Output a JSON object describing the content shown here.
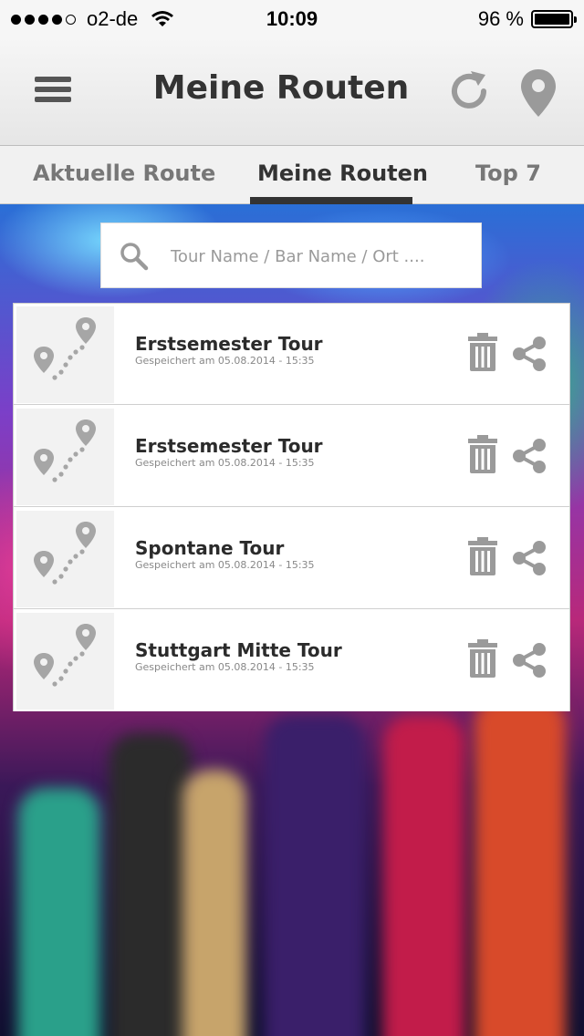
{
  "status_bar": {
    "carrier": "o2-de",
    "time": "10:09",
    "battery": "96 %",
    "signal_bars_filled": 4,
    "signal_bars_total": 5
  },
  "nav": {
    "title": "Meine Routen",
    "menu_icon": "hamburger-menu-icon",
    "refresh_icon": "refresh-icon",
    "location_icon": "location-pin-icon"
  },
  "tabs": [
    {
      "label": "Aktuelle Route",
      "active": false
    },
    {
      "label": "Meine Routen",
      "active": true
    },
    {
      "label": "Top 7",
      "active": false
    }
  ],
  "search": {
    "placeholder": "Tour Name / Bar Name / Ort ....",
    "value": "",
    "icon": "search-icon"
  },
  "routes": [
    {
      "title": "Erstsemester Tour",
      "subtitle": "Gespeichert am 05.08.2014 - 15:35"
    },
    {
      "title": "Erstsemester Tour",
      "subtitle": "Gespeichert am 05.08.2014 - 15:35"
    },
    {
      "title": "Spontane Tour",
      "subtitle": "Gespeichert am 05.08.2014 - 15:35"
    },
    {
      "title": "Stuttgart Mitte Tour",
      "subtitle": "Gespeichert am 05.08.2014 - 15:35"
    }
  ],
  "colors": {
    "accent": "#333333",
    "icon_gray": "#9a9a9a"
  }
}
